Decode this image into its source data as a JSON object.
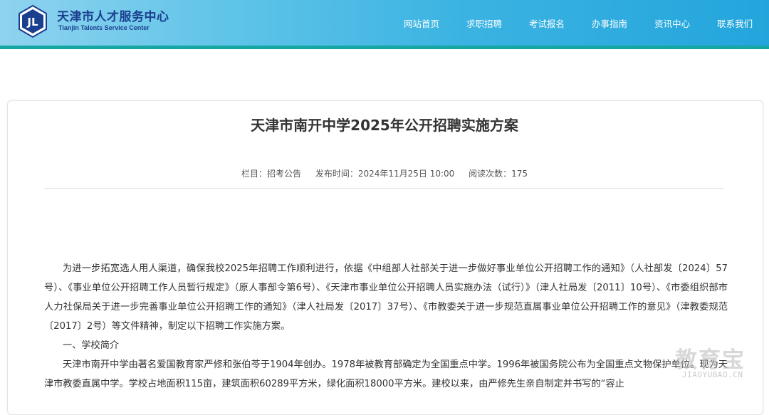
{
  "header": {
    "brand_cn": "天津市人才服务中心",
    "brand_en": "Tianjin Talents Service Center",
    "logo_text": "JL",
    "nav": [
      "网站首页",
      "求职招聘",
      "考试报名",
      "办事指南",
      "资讯中心",
      "联系我们"
    ]
  },
  "article": {
    "title": "天津市南开中学2025年公开招聘实施方案",
    "meta": {
      "column": "栏目：招考公告",
      "published": "发布时间：2024年11月25日 10:00",
      "views": "阅读次数：175"
    },
    "paragraphs": [
      "为进一步拓宽选人用人渠道，确保我校2025年招聘工作顺利进行，依据《中组部人社部关于进一步做好事业单位公开招聘工作的通知》（人社部发〔2024〕57号）、《事业单位公开招聘工作人员暂行规定》（原人事部令第6号）、《天津市事业单位公开招聘人员实施办法（试行）》（津人社局发〔2011〕10号）、《市委组织部市人力社保局关于进一步完善事业单位公开招聘工作的通知》（津人社局发〔2017〕37号）、《市教委关于进一步规范直属事业单位公开招聘工作的意见》（津教委规范〔2017〕2号）等文件精神，制定以下招聘工作实施方案。",
      "一、学校简介",
      "天津市南开中学由著名爱国教育家严修和张伯苓于1904年创办。1978年被教育部确定为全国重点中学。1996年被国务院公布为全国重点文物保护单位。现为天津市教委直属中学。学校占地面积115亩，建筑面积60289平方米，绿化面积18000平方米。建校以来，由严修先生亲自制定并书写的“容止"
    ]
  },
  "watermark": {
    "cn": "教育宝",
    "en": "JIAOYUBAO.CN"
  }
}
